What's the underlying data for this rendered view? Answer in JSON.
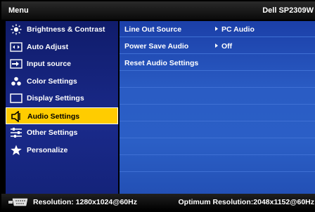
{
  "title": {
    "menu": "Menu",
    "model": "Dell SP2309W"
  },
  "sidebar": {
    "items": [
      {
        "label": "Brightness & Contrast",
        "icon": "brightness-icon",
        "selected": false
      },
      {
        "label": "Auto Adjust",
        "icon": "auto-adjust-icon",
        "selected": false
      },
      {
        "label": "Input source",
        "icon": "input-source-icon",
        "selected": false
      },
      {
        "label": "Color Settings",
        "icon": "color-settings-icon",
        "selected": false
      },
      {
        "label": "Display Settings",
        "icon": "display-settings-icon",
        "selected": false
      },
      {
        "label": "Audio Settings",
        "icon": "speaker-icon",
        "selected": true
      },
      {
        "label": "Other Settings",
        "icon": "other-settings-icon",
        "selected": false
      },
      {
        "label": "Personalize",
        "icon": "star-icon",
        "selected": false
      }
    ]
  },
  "main": {
    "rows": [
      {
        "label": "Line Out Source",
        "value": "PC Audio"
      },
      {
        "label": "Power Save Audio",
        "value": "Off"
      },
      {
        "label": "Reset Audio Settings",
        "value": ""
      }
    ]
  },
  "status": {
    "resolution": "Resolution: 1280x1024@60Hz",
    "optimum": "Optimum Resolution:2048x1152@60Hz"
  },
  "colors": {
    "selected": "#ffcc00",
    "sidebar": "#1a2a8a",
    "panel": "#2a5cc4"
  }
}
